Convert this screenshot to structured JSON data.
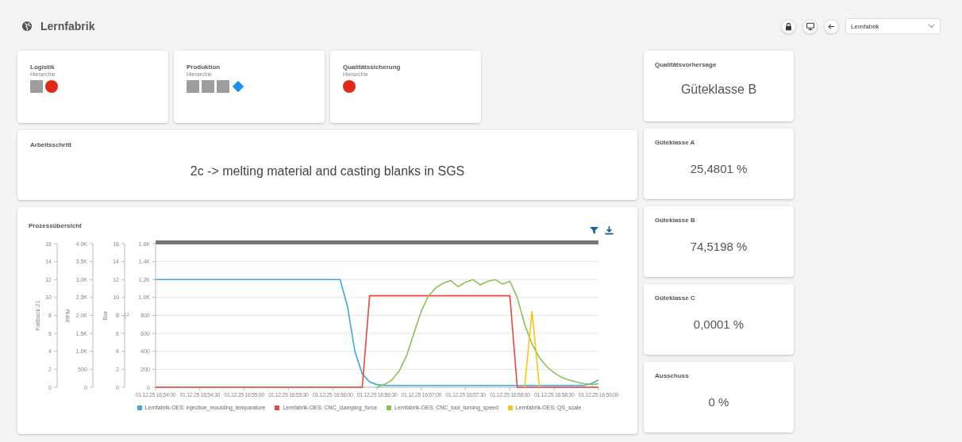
{
  "header": {
    "title": "Lernfabrik",
    "select": {
      "value": "Lernfabrik"
    }
  },
  "hierarchy_cards": [
    {
      "title": "Logistik",
      "subtitle": "Hierarchie",
      "markers": [
        {
          "kind": "square",
          "color": "#9e9e9e"
        },
        {
          "kind": "circle",
          "color": "#e0281c"
        }
      ]
    },
    {
      "title": "Produktion",
      "subtitle": "Hierarchie",
      "markers": [
        {
          "kind": "square",
          "color": "#9e9e9e"
        },
        {
          "kind": "square",
          "color": "#9e9e9e"
        },
        {
          "kind": "square",
          "color": "#9e9e9e"
        },
        {
          "kind": "diamond",
          "color": "#1e8fe8"
        }
      ]
    },
    {
      "title": "Qualitätssicherung",
      "subtitle": "Hierarchie",
      "markers": [
        {
          "kind": "circle",
          "color": "#e0281c"
        }
      ]
    }
  ],
  "work_step": {
    "title": "Arbeitsschritt",
    "value": "2c -> melting material and casting blanks in SGS"
  },
  "process_overview": {
    "title": "Prozessübersicht",
    "extra_axes": [
      {
        "title": "Fallback 21",
        "ticks": [
          "16",
          "14",
          "12",
          "10",
          "8",
          "6",
          "4",
          "2",
          "0"
        ]
      },
      {
        "title": "RPM",
        "ticks": [
          "4.0K",
          "3.5K",
          "3.0K",
          "2.5K",
          "2.0K",
          "1.5K",
          "1.0K",
          "500",
          "0"
        ]
      },
      {
        "title": "Bar",
        "ticks": [
          "16",
          "14",
          "12",
          "10",
          "8",
          "6",
          "4",
          "2",
          "0"
        ]
      }
    ],
    "chart_data": {
      "type": "line",
      "ylabel": "°C",
      "ylim": [
        0,
        1600
      ],
      "grid": true,
      "legend": true,
      "yticks": [
        0,
        200,
        400,
        600,
        800,
        {
          "value": 1000,
          "label": "1.0K"
        },
        {
          "value": 1200,
          "label": "1.2K"
        },
        {
          "value": 1400,
          "label": "1.4K"
        },
        {
          "value": 1600,
          "label": "1.6K"
        }
      ],
      "categories": [
        "01.12.25 16:54:00",
        null,
        null,
        null,
        null,
        null,
        "01.12.25 16:54:30",
        null,
        null,
        null,
        null,
        null,
        "01.12.25 16:55:00",
        null,
        null,
        null,
        null,
        null,
        "01.12.25 16:55:30",
        null,
        null,
        null,
        null,
        null,
        "01.12.25 16:56:00",
        null,
        null,
        null,
        null,
        null,
        "01.12.25 16:56:30",
        null,
        null,
        null,
        null,
        null,
        "01.12.25 16:57:00",
        null,
        null,
        null,
        null,
        null,
        "01.12.25 16:57:30",
        null,
        null,
        null,
        null,
        null,
        "01.12.25 16:58:00",
        null,
        null,
        null,
        null,
        null,
        "01.12.25 16:58:30",
        null,
        null,
        null,
        null,
        null,
        "01.12.25 16:59:00"
      ],
      "series": [
        {
          "name": "Lernfabrik-OES: injection_moulding_temparature",
          "color": "#3aa9e0",
          "values": [
            1200,
            1200,
            1200,
            1200,
            1200,
            1200,
            1200,
            1200,
            1200,
            1200,
            1200,
            1200,
            1200,
            1200,
            1200,
            1200,
            1200,
            1200,
            1200,
            1200,
            1200,
            1200,
            1200,
            1200,
            1200,
            1200,
            900,
            400,
            150,
            60,
            30,
            20,
            20,
            20,
            20,
            20,
            20,
            20,
            20,
            20,
            20,
            20,
            20,
            20,
            20,
            20,
            20,
            20,
            20,
            20,
            20,
            20,
            20,
            20,
            20,
            20,
            20,
            20,
            20,
            40,
            80
          ]
        },
        {
          "name": "Lernfabrik-OES: CNC_clamping_force",
          "color": "#e8473c",
          "values": [
            0,
            0,
            0,
            0,
            0,
            0,
            0,
            0,
            0,
            0,
            0,
            0,
            0,
            0,
            0,
            0,
            0,
            0,
            0,
            0,
            0,
            0,
            0,
            0,
            0,
            0,
            0,
            0,
            0,
            1020,
            1020,
            1020,
            1020,
            1020,
            1020,
            1020,
            1020,
            1020,
            1020,
            1020,
            1020,
            1020,
            1020,
            1020,
            1020,
            1020,
            1020,
            1020,
            1020,
            0,
            0,
            0,
            0,
            0,
            0,
            0,
            0,
            0,
            0,
            0,
            0
          ]
        },
        {
          "name": "Lernfabrik-OES: CNC_tool_turning_speed",
          "color": "#8cc152",
          "values": [
            null,
            null,
            null,
            null,
            null,
            null,
            null,
            null,
            null,
            null,
            null,
            null,
            null,
            null,
            null,
            null,
            null,
            null,
            null,
            null,
            null,
            null,
            null,
            null,
            null,
            null,
            null,
            null,
            null,
            null,
            0,
            30,
            80,
            180,
            350,
            600,
            850,
            1020,
            1110,
            1160,
            1190,
            1120,
            1170,
            1200,
            1140,
            1180,
            1200,
            1150,
            1180,
            1000,
            700,
            480,
            330,
            230,
            160,
            110,
            80,
            60,
            40,
            30,
            40
          ]
        },
        {
          "name": "Lernfabrik-OES: QS_scale",
          "color": "#f5c518",
          "values": [
            null,
            null,
            null,
            null,
            null,
            null,
            null,
            null,
            null,
            null,
            null,
            null,
            null,
            null,
            null,
            null,
            null,
            null,
            null,
            null,
            null,
            null,
            null,
            null,
            null,
            null,
            null,
            null,
            null,
            null,
            null,
            null,
            null,
            null,
            null,
            null,
            null,
            null,
            null,
            null,
            null,
            null,
            null,
            null,
            null,
            null,
            null,
            null,
            null,
            null,
            0,
            850,
            0,
            null,
            null,
            null,
            null,
            null,
            null,
            null,
            null
          ]
        }
      ]
    }
  },
  "kpi_cards": [
    {
      "kind": "prediction",
      "title": "Qualitätsvorhersage",
      "value": "Güteklasse B"
    },
    {
      "kind": "value",
      "title": "Güteklasse A",
      "value": "25,4801 %"
    },
    {
      "kind": "value",
      "title": "Güteklasse B",
      "value": "74,5198 %"
    },
    {
      "kind": "value",
      "title": "Güteklasse C",
      "value": "0,0001 %"
    },
    {
      "kind": "value",
      "title": "Ausschuss",
      "value": "0 %"
    }
  ]
}
